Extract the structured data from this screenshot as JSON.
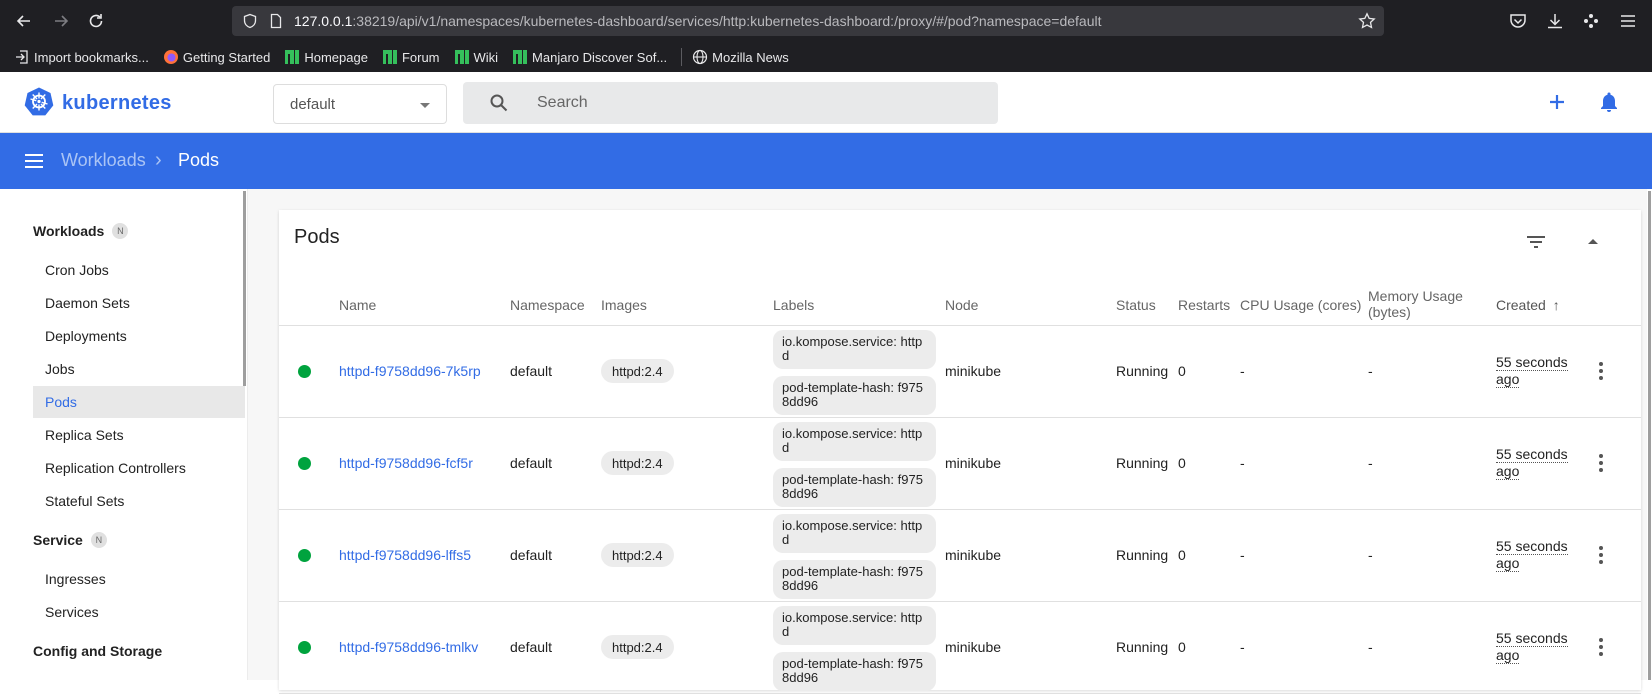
{
  "browser": {
    "url_host": "127.0.0.1",
    "url_rest": ":38219/api/v1/namespaces/kubernetes-dashboard/services/http:kubernetes-dashboard:/proxy/#/pod?namespace=default",
    "bookmarks": [
      {
        "label": "Import bookmarks...",
        "icon": "import-icon"
      },
      {
        "label": "Getting Started",
        "icon": "firefox-icon"
      },
      {
        "label": "Homepage",
        "icon": "manjaro-icon"
      },
      {
        "label": "Forum",
        "icon": "manjaro-icon"
      },
      {
        "label": "Wiki",
        "icon": "manjaro-icon"
      },
      {
        "label": "Manjaro Discover Sof...",
        "icon": "manjaro-icon"
      },
      {
        "label": "Mozilla News",
        "icon": "globe-icon"
      }
    ]
  },
  "header": {
    "brand": "kubernetes",
    "namespace": "default",
    "search_placeholder": "Search"
  },
  "breadcrumb": {
    "parent": "Workloads",
    "current": "Pods"
  },
  "sidebar": {
    "sections": [
      {
        "title": "Workloads",
        "badge": "N"
      },
      {
        "title": "Service",
        "badge": "N"
      },
      {
        "title": "Config and Storage"
      }
    ],
    "workload_items": [
      "Cron Jobs",
      "Daemon Sets",
      "Deployments",
      "Jobs",
      "Pods",
      "Replica Sets",
      "Replication Controllers",
      "Stateful Sets"
    ],
    "service_items": [
      "Ingresses",
      "Services"
    ],
    "active_item": "Pods"
  },
  "pods": {
    "title": "Pods",
    "columns": {
      "name": "Name",
      "namespace": "Namespace",
      "images": "Images",
      "labels": "Labels",
      "node": "Node",
      "status": "Status",
      "restarts": "Restarts",
      "cpu": "CPU Usage (cores)",
      "memory_line1": "Memory Usage",
      "memory_line2": "(bytes)",
      "created": "Created",
      "created_sort": "↑"
    },
    "rows": [
      {
        "name": "httpd-f9758dd96-7k5rp",
        "namespace": "default",
        "image": "httpd:2.4",
        "label1": "io.kompose.service: httpd",
        "label2": "pod-template-hash: f9758dd96",
        "node": "minikube",
        "status": "Running",
        "restarts": "0",
        "cpu": "-",
        "memory": "-",
        "created": "55 seconds ago",
        "status_color": "#00a33e"
      },
      {
        "name": "httpd-f9758dd96-fcf5r",
        "namespace": "default",
        "image": "httpd:2.4",
        "label1": "io.kompose.service: httpd",
        "label2": "pod-template-hash: f9758dd96",
        "node": "minikube",
        "status": "Running",
        "restarts": "0",
        "cpu": "-",
        "memory": "-",
        "created": "55 seconds ago",
        "status_color": "#00a33e"
      },
      {
        "name": "httpd-f9758dd96-lffs5",
        "namespace": "default",
        "image": "httpd:2.4",
        "label1": "io.kompose.service: httpd",
        "label2": "pod-template-hash: f9758dd96",
        "node": "minikube",
        "status": "Running",
        "restarts": "0",
        "cpu": "-",
        "memory": "-",
        "created": "55 seconds ago",
        "status_color": "#00a33e"
      },
      {
        "name": "httpd-f9758dd96-tmlkv",
        "namespace": "default",
        "image": "httpd:2.4",
        "label1": "io.kompose.service: httpd",
        "label2": "pod-template-hash: f9758dd96",
        "node": "minikube",
        "status": "Running",
        "restarts": "0",
        "cpu": "-",
        "memory": "-",
        "created": "55 seconds ago",
        "status_color": "#00a33e"
      }
    ]
  },
  "colors": {
    "brand": "#326ce5",
    "running": "#00a33e"
  }
}
